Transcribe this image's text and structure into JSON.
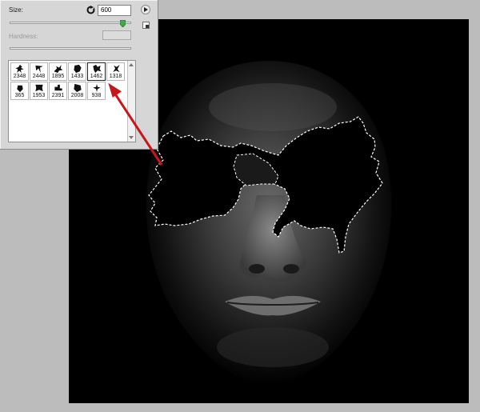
{
  "brush_panel": {
    "size_label": "Size:",
    "size_value": "600",
    "hardness_label": "Hardness:",
    "size_slider_level": 0.93,
    "brushes": [
      {
        "size": "2348",
        "icon": "splatter-brush-icon",
        "selected": false
      },
      {
        "size": "2448",
        "icon": "splatter-brush-icon",
        "selected": false
      },
      {
        "size": "1895",
        "icon": "splatter-brush-icon",
        "selected": false
      },
      {
        "size": "1433",
        "icon": "splatter-brush-icon",
        "selected": false
      },
      {
        "size": "1462",
        "icon": "splatter-brush-icon",
        "selected": true
      },
      {
        "size": "1318",
        "icon": "splatter-brush-icon",
        "selected": false
      },
      {
        "size": "365",
        "icon": "splatter-brush-icon",
        "selected": false
      },
      {
        "size": "1953",
        "icon": "splatter-brush-icon",
        "selected": false
      },
      {
        "size": "2391",
        "icon": "splatter-brush-icon",
        "selected": false
      },
      {
        "size": "2008",
        "icon": "splatter-brush-icon",
        "selected": false
      },
      {
        "size": "938",
        "icon": "splatter-brush-icon",
        "selected": false
      }
    ]
  },
  "colors": {
    "workspace": "#bcbcbc",
    "panel": "#d6d6d6",
    "canvas": "#000000",
    "arrow": "#c8161d",
    "selection_marquee": "#ffffff"
  }
}
